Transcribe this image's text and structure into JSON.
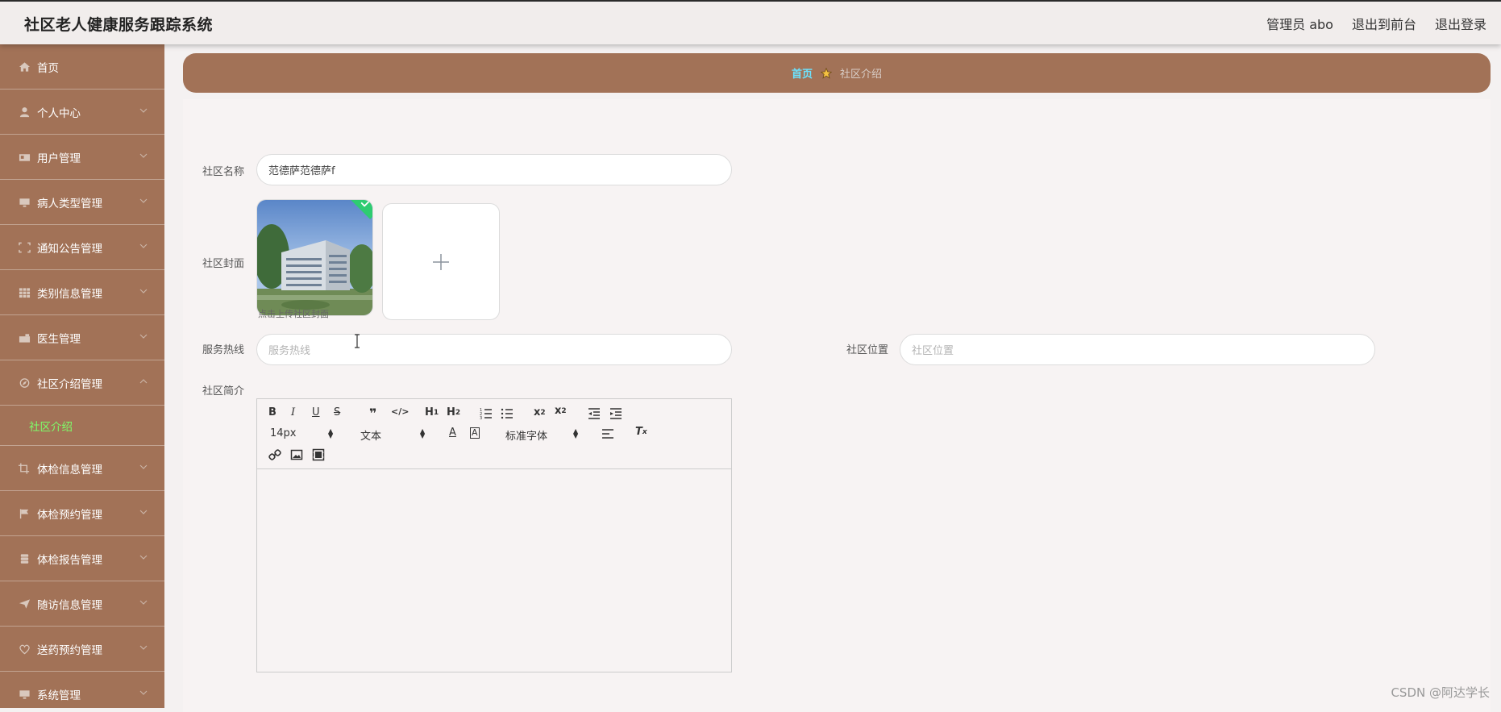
{
  "header": {
    "title": "社区老人健康服务跟踪系统",
    "user": "管理员 abo",
    "front_link": "退出到前台",
    "logout_link": "退出登录"
  },
  "sidebar": {
    "items": [
      {
        "label": "首页",
        "icon": "home-icon",
        "chevron": false
      },
      {
        "label": "个人中心",
        "icon": "user-icon",
        "chevron": true
      },
      {
        "label": "用户管理",
        "icon": "id-card-icon",
        "chevron": true
      },
      {
        "label": "病人类型管理",
        "icon": "monitor-icon",
        "chevron": true
      },
      {
        "label": "通知公告管理",
        "icon": "fullscreen-icon",
        "chevron": true
      },
      {
        "label": "类别信息管理",
        "icon": "grid-icon",
        "chevron": true
      },
      {
        "label": "医生管理",
        "icon": "case-icon",
        "chevron": true
      },
      {
        "label": "社区介绍管理",
        "icon": "compass-icon",
        "chevron": true,
        "expanded": true
      },
      {
        "label": "体检信息管理",
        "icon": "crop-icon",
        "chevron": true
      },
      {
        "label": "体检预约管理",
        "icon": "flag-icon",
        "chevron": true
      },
      {
        "label": "体检报告管理",
        "icon": "database-icon",
        "chevron": true
      },
      {
        "label": "随访信息管理",
        "icon": "send-icon",
        "chevron": true
      },
      {
        "label": "送药预约管理",
        "icon": "heart-icon",
        "chevron": true
      },
      {
        "label": "系统管理",
        "icon": "monitor-icon",
        "chevron": true
      }
    ],
    "submenu_label": "社区介绍"
  },
  "breadcrumb": {
    "home": "首页",
    "current": "社区介绍"
  },
  "form": {
    "name_label": "社区名称",
    "name_value": "范德萨范德萨f",
    "cover_label": "社区封面",
    "upload_tip": "点击上传社区封面",
    "hotline_label": "服务热线",
    "hotline_placeholder": "服务热线",
    "location_label": "社区位置",
    "location_placeholder": "社区位置",
    "intro_label": "社区简介"
  },
  "editor": {
    "font_size": "14px",
    "header_select": "文本",
    "font_family": "标准字体"
  },
  "colors": {
    "sidebar_bg": "#a27257",
    "breadcrumb_home": "#6be3ff",
    "active_submenu": "#7dff6a"
  },
  "watermark": "CSDN @阿达学长"
}
